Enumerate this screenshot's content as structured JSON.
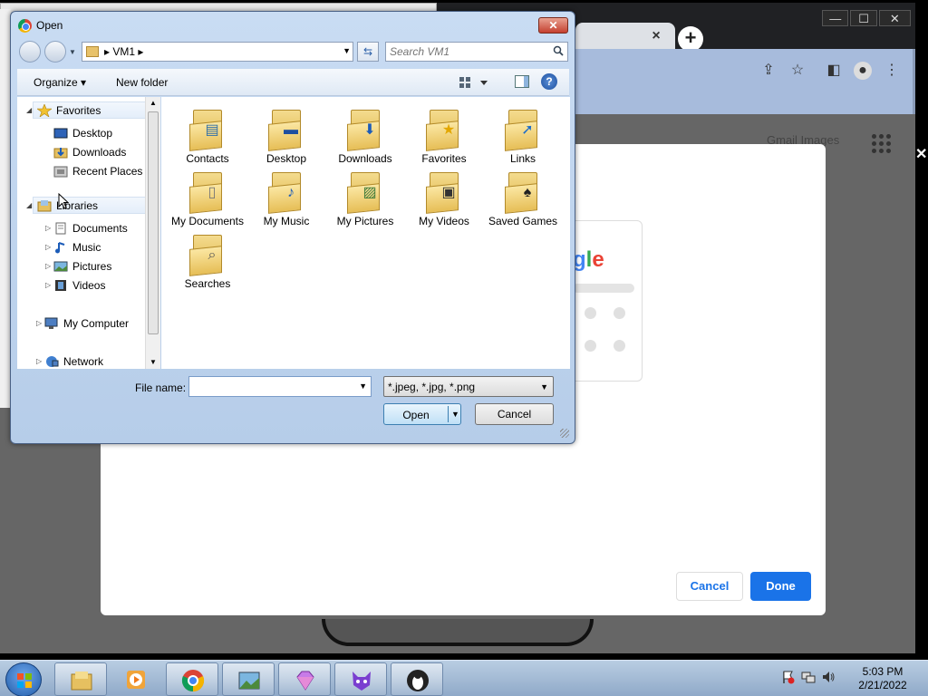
{
  "dialog": {
    "title": "Open",
    "close_label": "✕",
    "address_crumb": "VM1",
    "search_placeholder": "Search VM1",
    "toolbar": {
      "organize": "Organize",
      "new_folder": "New folder"
    },
    "nav": {
      "favorites": "Favorites",
      "desktop": "Desktop",
      "downloads": "Downloads",
      "recent_places": "Recent Places",
      "libraries": "Libraries",
      "documents": "Documents",
      "music": "Music",
      "pictures": "Pictures",
      "videos": "Videos",
      "my_computer": "My Computer",
      "network": "Network"
    },
    "files": [
      "Contacts",
      "Desktop",
      "Downloads",
      "Favorites",
      "Links",
      "My Documents",
      "My Music",
      "My Pictures",
      "My Videos",
      "Saved Games",
      "Searches"
    ],
    "file_name_label": "File name:",
    "file_name_value": "",
    "file_type": "*.jpeg, *.jpg, *.png",
    "open_label": "Open",
    "cancel_label": "Cancel"
  },
  "chrome": {
    "tab_close": "×",
    "new_tab": "+",
    "header_links": "Gmail  Images",
    "modal_logo_fragment": "gle",
    "modal_cancel": "Cancel",
    "modal_done": "Done",
    "window_controls": [
      "—",
      "☐",
      "✕"
    ],
    "x_mark": "✕"
  },
  "taskbar": {
    "apps": [
      "explorer",
      "media-player",
      "chrome",
      "photo-viewer",
      "gem-app",
      "cat-app",
      "tux-app"
    ],
    "time": "5:03 PM",
    "date": "2/21/2022"
  },
  "colors": {
    "accent_blue": "#1a73e8",
    "dialog_frame": "#c9dcf3"
  }
}
